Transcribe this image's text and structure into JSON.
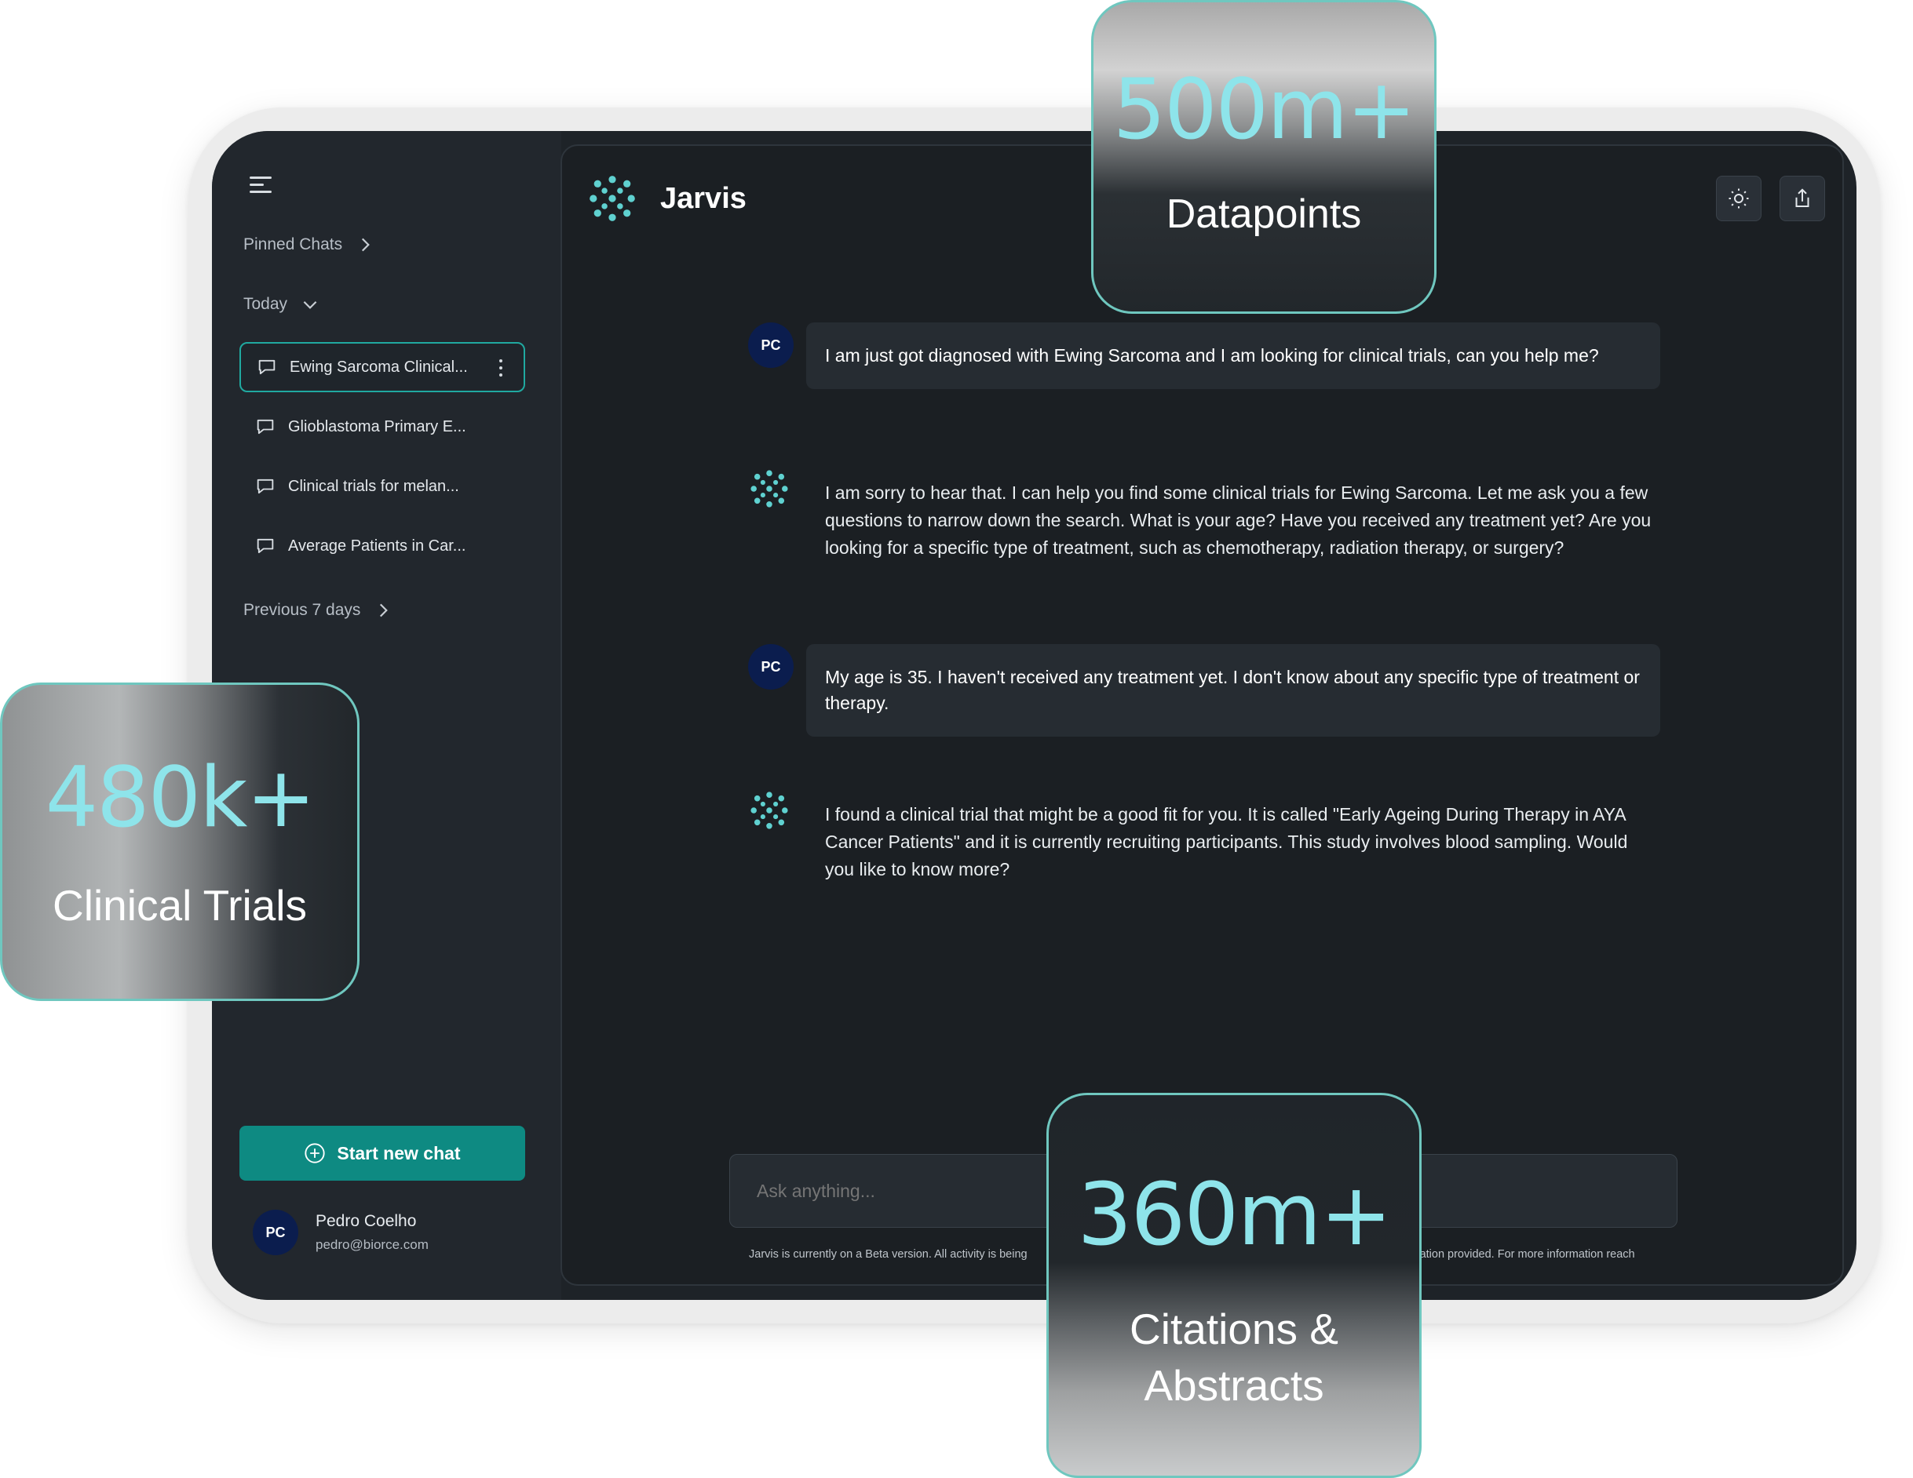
{
  "sidebar": {
    "pinned_label": "Pinned Chats",
    "today_label": "Today",
    "previous_label": "Previous 7 days",
    "chats": [
      {
        "title": "Ewing Sarcoma Clinical...",
        "active": true
      },
      {
        "title": "Glioblastoma Primary E...",
        "active": false
      },
      {
        "title": "Clinical trials for melan...",
        "active": false
      },
      {
        "title": "Average Patients in Car...",
        "active": false
      }
    ],
    "new_chat_label": "Start new chat",
    "user": {
      "initials": "PC",
      "name": "Pedro Coelho",
      "email": "pedro@biorce.com"
    }
  },
  "header": {
    "app_name": "Jarvis",
    "icons": [
      "sun-icon",
      "share-icon"
    ]
  },
  "messages": [
    {
      "role": "user",
      "initials": "PC",
      "text": "I am just got diagnosed with Ewing Sarcoma and I am looking for clinical trials, can you help me?"
    },
    {
      "role": "assistant",
      "text": "I am sorry to hear that. I can help you find some clinical trials for Ewing Sarcoma. Let me ask you a few questions to narrow down the search. What is your age? Have you received any treatment yet? Are you looking for a specific type of treatment, such as chemotherapy, radiation therapy, or surgery?"
    },
    {
      "role": "user",
      "initials": "PC",
      "text": "My age is 35. I haven't received any treatment yet. I don't know about any specific type of treatment or therapy."
    },
    {
      "role": "assistant",
      "text": "I found a clinical trial that might be a good fit for you. It is called \"Early Ageing During Therapy in AYA Cancer Patients\" and it is currently recruiting participants. This study involves blood sampling. Would you like to know more?"
    }
  ],
  "composer": {
    "placeholder": "Ask anything..."
  },
  "disclaimer": {
    "left": "Jarvis is currently on a Beta version. All activity is being",
    "right": "rmation provided. For more information reach"
  },
  "stats": [
    {
      "value": "500m+",
      "label": "Datapoints"
    },
    {
      "value": "480k+",
      "label": "Clinical Trials"
    },
    {
      "value": "360m+",
      "label": "Citations &\nAbstracts"
    }
  ],
  "colors": {
    "accent": "#0e8a82",
    "accent_border": "#20a9a0",
    "brand_teal": "#5fd1d0",
    "stat_value": "#8ee4ea",
    "avatar_bg": "#0b1d4e",
    "background": "#1b1f23"
  }
}
